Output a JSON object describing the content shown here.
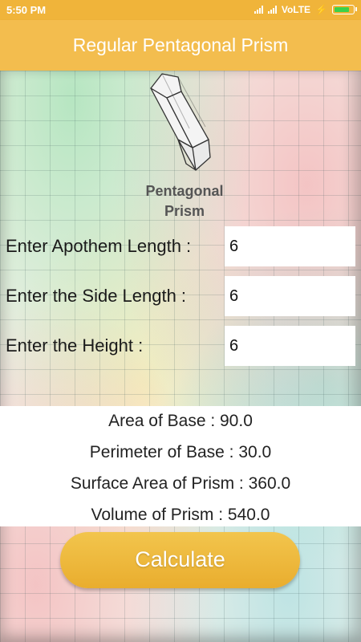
{
  "status_bar": {
    "time": "5:50 PM",
    "network": "VoLTE",
    "icons": [
      "signal-icon",
      "signal-icon",
      "charging-icon",
      "battery-icon"
    ]
  },
  "app_bar": {
    "title": "Regular Pentagonal Prism"
  },
  "illustration": {
    "caption_line1": "Pentagonal",
    "caption_line2": "Prism"
  },
  "form": {
    "apothem": {
      "label": "Enter Apothem Length :",
      "value": "6"
    },
    "side": {
      "label": "Enter the Side Length :",
      "value": "6"
    },
    "height": {
      "label": "Enter the Height :",
      "value": "6"
    }
  },
  "results": {
    "area_of_base": "Area of Base : 90.0",
    "perimeter_of_base": "Perimeter of Base : 30.0",
    "surface_area": "Surface Area of Prism : 360.0",
    "volume": "Volume of Prism : 540.0"
  },
  "actions": {
    "calculate_label": "Calculate"
  },
  "colors": {
    "accent": "#f3bd4e",
    "status_bar": "#f0b43a",
    "battery_fill": "#3bd14a"
  }
}
